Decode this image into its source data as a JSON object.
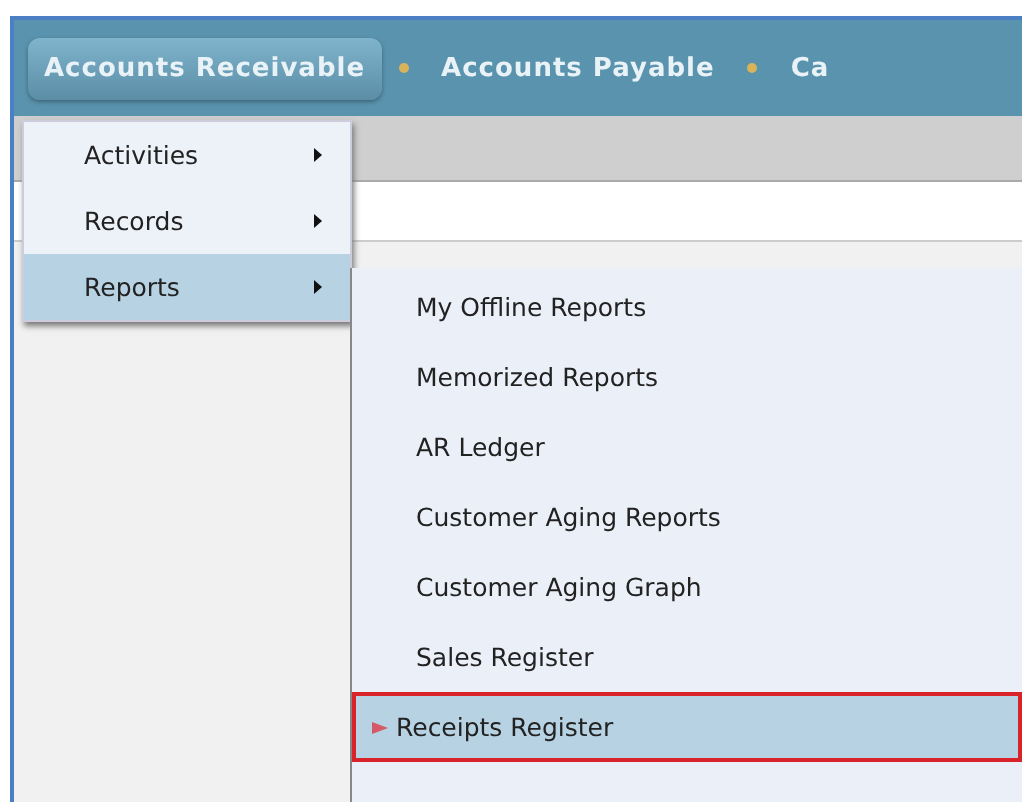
{
  "nav": {
    "tabs": [
      {
        "label": "Accounts Receivable",
        "selected": true
      },
      {
        "label": "Accounts Payable",
        "selected": false
      },
      {
        "label": "Ca",
        "selected": false
      }
    ]
  },
  "menu": {
    "items": [
      {
        "label": "Activities",
        "selected": false
      },
      {
        "label": "Records",
        "selected": false
      },
      {
        "label": "Reports",
        "selected": true
      }
    ]
  },
  "submenu": {
    "items": [
      {
        "label": "My Offline Reports",
        "selected": false
      },
      {
        "label": "Memorized Reports",
        "selected": false
      },
      {
        "label": "AR Ledger",
        "selected": false
      },
      {
        "label": "Customer Aging Reports",
        "selected": false
      },
      {
        "label": "Customer Aging Graph",
        "selected": false
      },
      {
        "label": "Sales Register",
        "selected": false
      },
      {
        "label": "Receipts Register",
        "selected": true
      }
    ]
  }
}
